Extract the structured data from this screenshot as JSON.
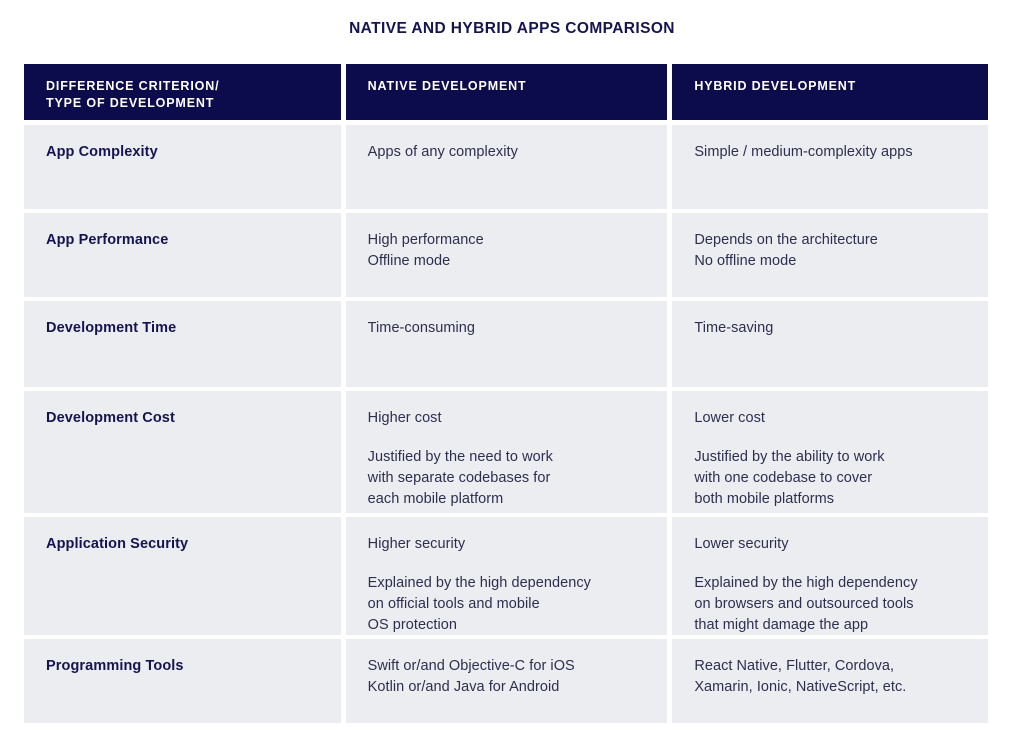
{
  "title": "NATIVE AND HYBRID APPS COMPARISON",
  "colors": {
    "header_bg": "#0c0c4c",
    "cell_bg": "#ecedf1",
    "title_text": "#161350",
    "criterion_text": "#161350",
    "body_text": "#2e2e4f",
    "page_bg": "#ffffff"
  },
  "table": {
    "headers": [
      "DIFFERENCE CRITERION/\nTYPE OF DEVELOPMENT",
      "NATIVE DEVELOPMENT",
      "HYBRID DEVELOPMENT"
    ],
    "rows": [
      {
        "criterion": "App Complexity",
        "native": [
          "Apps of any complexity"
        ],
        "hybrid": [
          "Simple / medium-complexity apps"
        ]
      },
      {
        "criterion": "App Performance",
        "native": [
          "High performance\nOffline mode"
        ],
        "hybrid": [
          "Depends on the architecture\nNo offline mode"
        ]
      },
      {
        "criterion": "Development Time",
        "native": [
          "Time-consuming"
        ],
        "hybrid": [
          "Time-saving"
        ]
      },
      {
        "criterion": "Development Cost",
        "native": [
          "Higher cost",
          "Justified by the need to work\nwith separate codebases for\neach mobile platform"
        ],
        "hybrid": [
          "Lower cost",
          "Justified by the ability to work\nwith one codebase to cover\nboth mobile platforms"
        ]
      },
      {
        "criterion": "Application Security",
        "native": [
          "Higher security",
          "Explained by the high dependency\non official tools and mobile\nOS protection"
        ],
        "hybrid": [
          "Lower security",
          "Explained by the high dependency\non browsers and outsourced tools\nthat might damage the app"
        ]
      },
      {
        "criterion": "Programming Tools",
        "native": [
          "Swift or/and Objective-C for iOS\nKotlin or/and Java for Android"
        ],
        "hybrid": [
          "React Native, Flutter, Cordova,\nXamarin, Ionic, NativeScript, etc."
        ]
      }
    ]
  }
}
